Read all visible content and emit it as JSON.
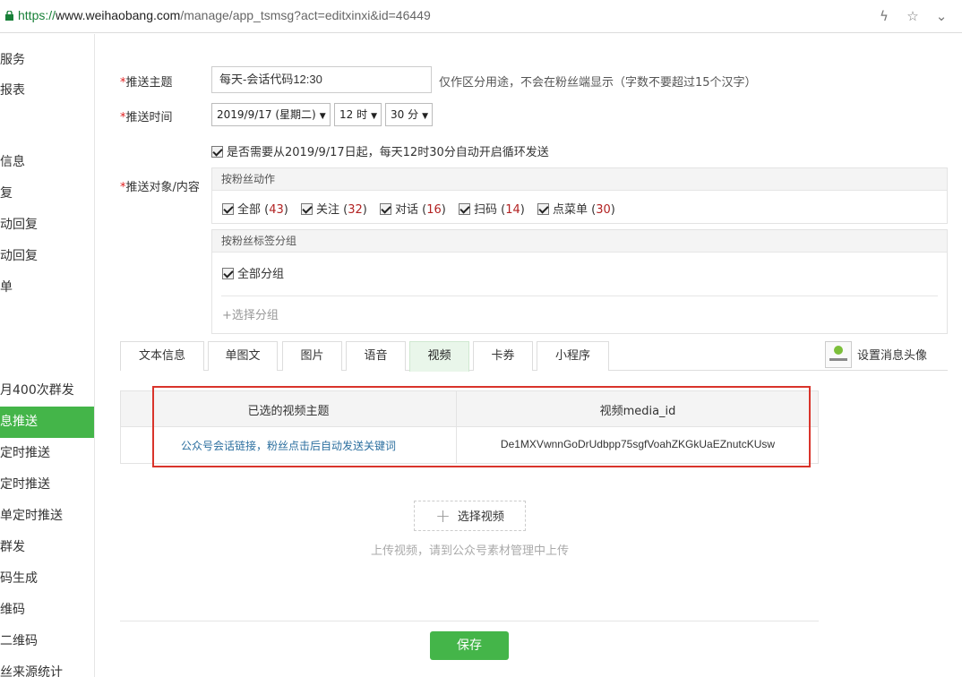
{
  "browser": {
    "url_scheme": "https://",
    "url_host": "www.weihaobang.com",
    "url_path": "/manage/app_tsmsg?act=editxinxi&id=46449"
  },
  "sidebar": {
    "items": [
      {
        "label": "服务",
        "active": false
      },
      {
        "label": "报表",
        "active": false
      },
      {
        "label": "信息",
        "active": false
      },
      {
        "label": "复",
        "active": false
      },
      {
        "label": "动回复",
        "active": false
      },
      {
        "label": "动回复",
        "active": false
      },
      {
        "label": "单",
        "active": false
      },
      {
        "label": "月400次群发",
        "active": false
      },
      {
        "label": "息推送",
        "active": true
      },
      {
        "label": "定时推送",
        "active": false
      },
      {
        "label": "定时推送",
        "active": false
      },
      {
        "label": "单定时推送",
        "active": false
      },
      {
        "label": "群发",
        "active": false
      },
      {
        "label": "码生成",
        "active": false
      },
      {
        "label": "维码",
        "active": false
      },
      {
        "label": "二维码",
        "active": false
      },
      {
        "label": "丝来源统计",
        "active": false
      }
    ]
  },
  "form": {
    "required_mark": "*",
    "subject_label": "推送主题",
    "subject_value": "每天-会话代码12:30",
    "subject_hint": "仅作区分用途，不会在粉丝端显示（字数不要超过15个汉字）",
    "time_label": "推送时间",
    "date_value": "2019/9/17 (星期二)",
    "hour_value": "12 时",
    "minute_value": "30 分",
    "loop_checked": true,
    "loop_text": "是否需要从2019/9/17日起，每天12时30分自动开启循环发送",
    "target_label": "推送对象/内容",
    "fan_action_header": "按粉丝动作",
    "fan_actions": [
      {
        "label": "全部",
        "count": "43"
      },
      {
        "label": "关注",
        "count": "32"
      },
      {
        "label": "对话",
        "count": "16"
      },
      {
        "label": "扫码",
        "count": "14"
      },
      {
        "label": "点菜单",
        "count": "30"
      }
    ],
    "fan_tag_header": "按粉丝标签分组",
    "all_groups_label": "全部分组",
    "add_group_label": "+选择分组"
  },
  "tabs": [
    {
      "label": "文本信息",
      "active": false
    },
    {
      "label": "单图文",
      "active": false
    },
    {
      "label": "图片",
      "active": false
    },
    {
      "label": "语音",
      "active": false
    },
    {
      "label": "视频",
      "active": true
    },
    {
      "label": "卡券",
      "active": false
    },
    {
      "label": "小程序",
      "active": false
    }
  ],
  "avatar_setting_label": "设置消息头像",
  "video_table": {
    "col_subject": "已选的视频主题",
    "col_media_id": "视频media_id",
    "rows": [
      {
        "subject": "公众号会话链接，粉丝点击后自动发送关键词",
        "media_id": "De1MXVwnnGoDrUdbpp75sgfVoahZKGkUaEZnutcKUsw"
      }
    ]
  },
  "choose_video_label": "选择视频",
  "upload_hint": "上传视频，请到公众号素材管理中上传",
  "save_label": "保存",
  "colors": {
    "accent_green": "#44b549",
    "highlight_red": "#d9342b",
    "count_red": "#b22222"
  }
}
